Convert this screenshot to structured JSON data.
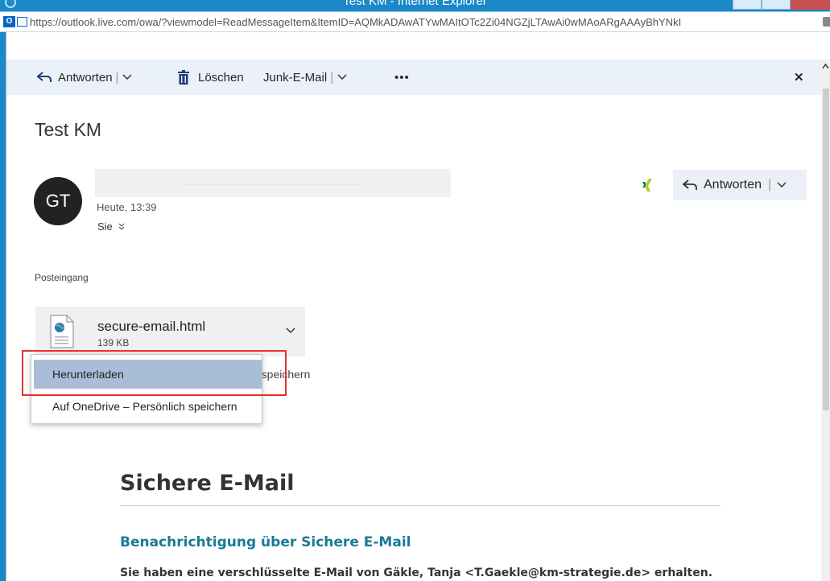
{
  "window": {
    "title": "Test KM - Internet Explorer"
  },
  "addressbar": {
    "url": "https://outlook.live.com/owa/?viewmodel=ReadMessageItem&ItemID=AQMkADAwATYwMAItOTc2Zi04NGZjLTAwAi0wMAoARgAAAyBhYNkI",
    "site_icon_letter": "O"
  },
  "toolbar": {
    "reply_label": "Antworten",
    "delete_label": "Löschen",
    "junk_label": "Junk-E-Mail",
    "more_label": "•••",
    "close_label": "✕"
  },
  "message": {
    "subject": "Test KM",
    "avatar_initials": "GT",
    "time": "Heute, 13:39",
    "to": "Sie",
    "reply_button_label": "Antworten",
    "folder": "Posteingang"
  },
  "attachment": {
    "name": "secure-email.html",
    "size": "139 KB",
    "behind_text": "h speichern"
  },
  "menu": {
    "items": [
      {
        "label": "Herunterladen"
      },
      {
        "label": "Auf OneDrive – Persönlich speichern"
      }
    ]
  },
  "email_body": {
    "title": "Sichere E-Mail",
    "subtitle": "Benachrichtigung über Sichere E-Mail",
    "text": "Sie haben eine verschlüsselte E-Mail von Gäkle, Tanja <T.Gaekle@km-strategie.de> erhalten."
  },
  "colors": {
    "accent": "#1a88c9",
    "toolbar_bg": "#eaf1f8",
    "menu_highlight": "#a9bdd8",
    "annotation_red": "#e53030",
    "link_teal": "#1a7a96"
  }
}
